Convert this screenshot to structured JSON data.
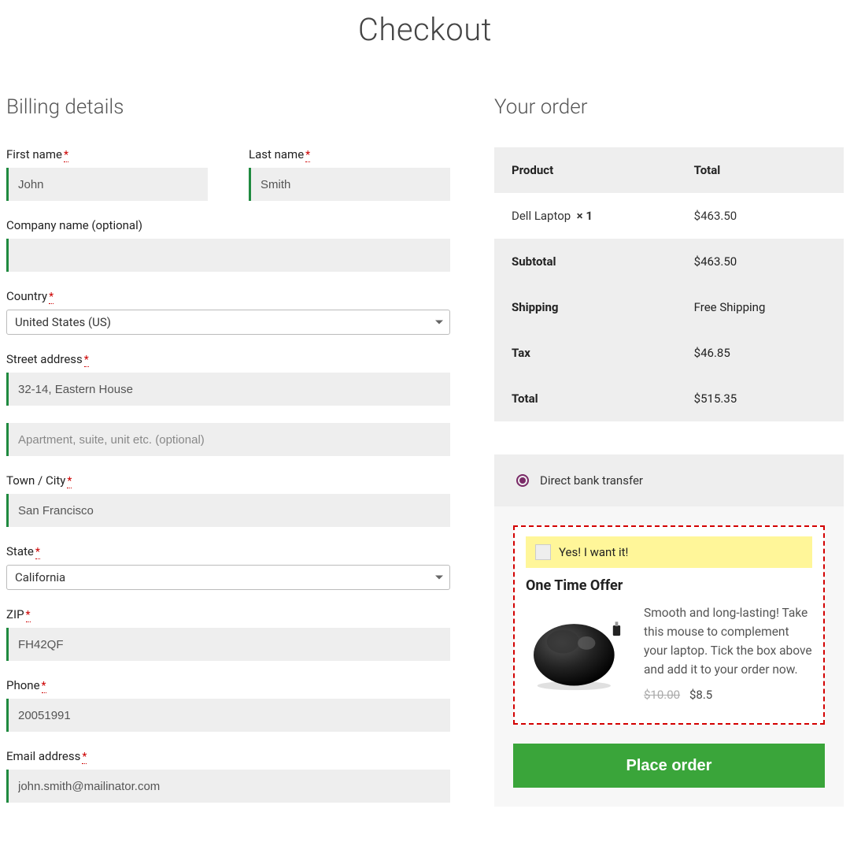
{
  "page": {
    "title": "Checkout"
  },
  "billing": {
    "heading": "Billing details",
    "first_name": {
      "label": "First name",
      "value": "John"
    },
    "last_name": {
      "label": "Last name",
      "value": "Smith"
    },
    "company": {
      "label": "Company name (optional)",
      "value": ""
    },
    "country": {
      "label": "Country",
      "value": "United States (US)"
    },
    "street": {
      "label": "Street address",
      "value": "32-14, Eastern House"
    },
    "street2": {
      "placeholder": "Apartment, suite, unit etc. (optional)",
      "value": ""
    },
    "city": {
      "label": "Town / City",
      "value": "San Francisco"
    },
    "state": {
      "label": "State",
      "value": "California"
    },
    "zip": {
      "label": "ZIP",
      "value": "FH42QF"
    },
    "phone": {
      "label": "Phone",
      "value": "20051991"
    },
    "email": {
      "label": "Email address",
      "value": "john.smith@mailinator.com"
    }
  },
  "order": {
    "heading": "Your order",
    "columns": {
      "product": "Product",
      "total": "Total"
    },
    "items": [
      {
        "name": "Dell Laptop",
        "qty_prefix": "× ",
        "qty": "1",
        "total": "$463.50"
      }
    ],
    "rows": {
      "subtotal": {
        "label": "Subtotal",
        "value": "$463.50"
      },
      "shipping": {
        "label": "Shipping",
        "value": "Free Shipping"
      },
      "tax": {
        "label": "Tax",
        "value": "$46.85"
      },
      "total": {
        "label": "Total",
        "value": "$515.35"
      }
    }
  },
  "payment": {
    "method": "Direct bank transfer",
    "offer": {
      "want_label": "Yes! I want it!",
      "title": "One Time Offer",
      "desc": "Smooth and long-lasting! Take this mouse to complement your laptop. Tick the box above and add it to your order now.",
      "old_price": "$10.00",
      "new_price": "$8.5"
    },
    "place_label": "Place order"
  }
}
